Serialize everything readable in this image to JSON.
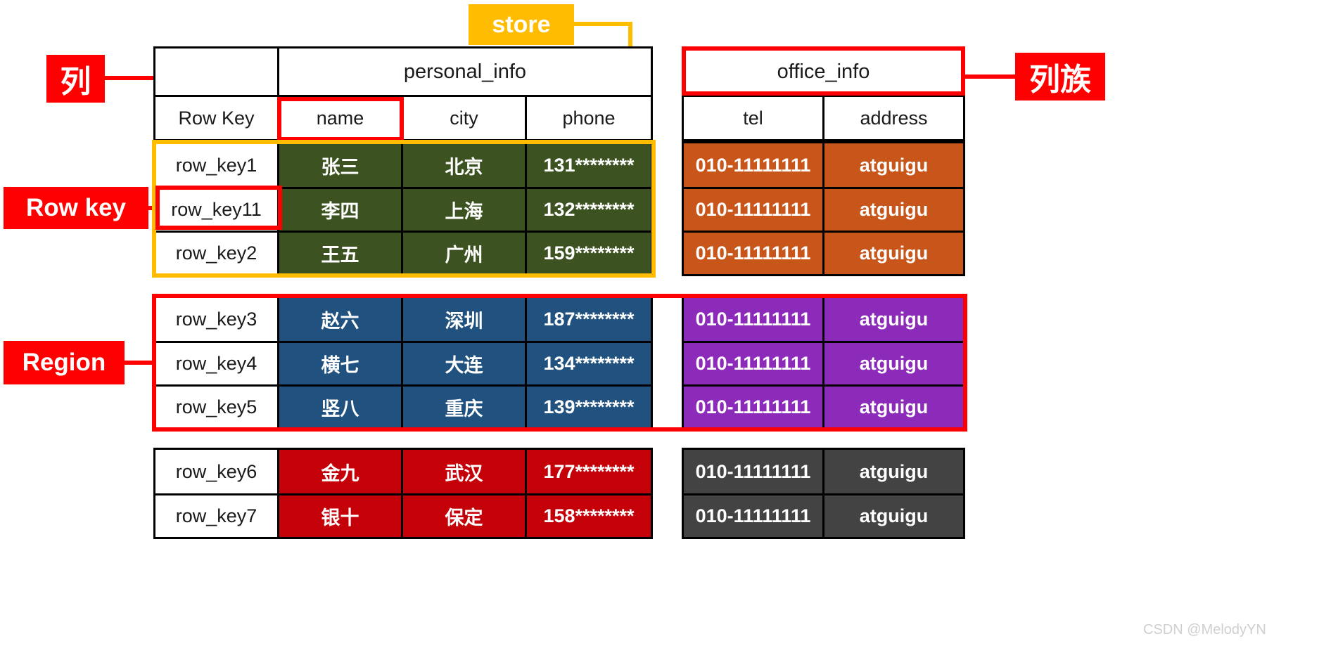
{
  "annotations": {
    "column": "列",
    "column_family": "列族",
    "row_key": "Row key",
    "region": "Region",
    "store": "store"
  },
  "column_families": {
    "personal_info": "personal_info",
    "office_info": "office_info"
  },
  "headers": {
    "row_key": "Row Key",
    "name": "name",
    "city": "city",
    "phone": "phone",
    "tel": "tel",
    "address": "address"
  },
  "groups": [
    {
      "id": "group-1",
      "personal_color": "#3c5220",
      "office_color": "#c8561a",
      "rows": [
        {
          "row_key": "row_key1",
          "name": "张三",
          "city": "北京",
          "phone": "131********",
          "tel": "010-11111111",
          "address": "atguigu"
        },
        {
          "row_key": "row_key11",
          "name": "李四",
          "city": "上海",
          "phone": "132********",
          "tel": "010-11111111",
          "address": "atguigu"
        },
        {
          "row_key": "row_key2",
          "name": "王五",
          "city": "广州",
          "phone": "159********",
          "tel": "010-11111111",
          "address": "atguigu"
        }
      ]
    },
    {
      "id": "group-2",
      "personal_color": "#21527f",
      "office_color": "#8c2bb9",
      "rows": [
        {
          "row_key": "row_key3",
          "name": "赵六",
          "city": "深圳",
          "phone": "187********",
          "tel": "010-11111111",
          "address": "atguigu"
        },
        {
          "row_key": "row_key4",
          "name": "横七",
          "city": "大连",
          "phone": "134********",
          "tel": "010-11111111",
          "address": "atguigu"
        },
        {
          "row_key": "row_key5",
          "name": "竖八",
          "city": "重庆",
          "phone": "139********",
          "tel": "010-11111111",
          "address": "atguigu"
        }
      ]
    },
    {
      "id": "group-3",
      "personal_color": "#c40008",
      "office_color": "#434343",
      "rows": [
        {
          "row_key": "row_key6",
          "name": "金九",
          "city": "武汉",
          "phone": "177********",
          "tel": "010-11111111",
          "address": "atguigu"
        },
        {
          "row_key": "row_key7",
          "name": "银十",
          "city": "保定",
          "phone": "158********",
          "tel": "010-11111111",
          "address": "atguigu"
        }
      ]
    }
  ],
  "watermark": "CSDN @MelodyYN",
  "colors": {
    "accent_red": "#fe0000",
    "accent_orange": "#ffbc01",
    "green": "#3c5220",
    "orange": "#c8561a",
    "blue": "#21527f",
    "purple": "#8c2bb9",
    "red": "#c40008",
    "gray": "#434343"
  }
}
